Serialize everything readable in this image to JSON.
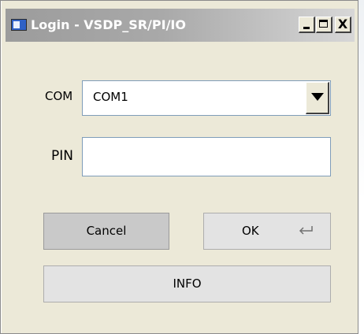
{
  "window": {
    "title": "Login - VSDP_SR/PI/IO",
    "minimize_label": "_",
    "maximize_label": "",
    "close_label": "X"
  },
  "form": {
    "com_label": "COM",
    "com_selected": "COM1",
    "pin_label": "PIN",
    "pin_value": ""
  },
  "buttons": {
    "cancel_label": "Cancel",
    "ok_label": "OK",
    "info_label": "INFO"
  },
  "icons": {
    "app": "app-window-icon",
    "dropdown": "dropdown-arrow-icon",
    "enter": "enter-key-icon"
  }
}
